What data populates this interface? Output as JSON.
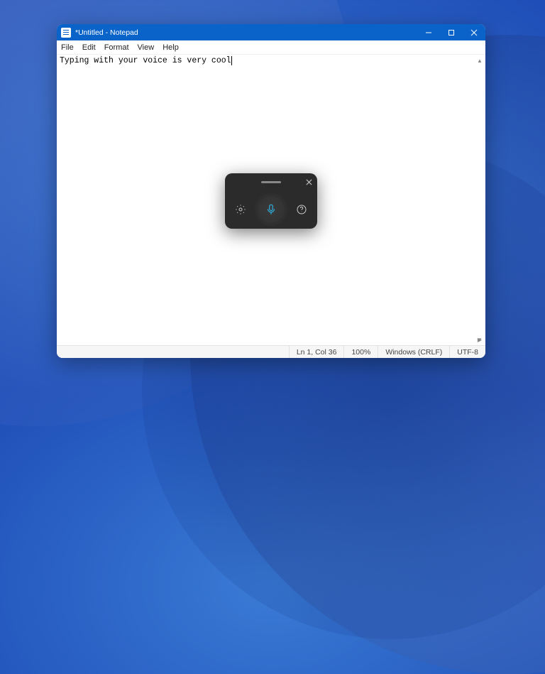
{
  "window": {
    "title": "*Untitled - Notepad"
  },
  "menu": {
    "file": "File",
    "edit": "Edit",
    "format": "Format",
    "view": "View",
    "help": "Help"
  },
  "editor": {
    "content": "Typing with your voice is very cool"
  },
  "status": {
    "position": "Ln 1, Col 36",
    "zoom": "100%",
    "line_ending": "Windows (CRLF)",
    "encoding": "UTF-8"
  },
  "voice_panel": {
    "settings_icon": "settings",
    "mic_icon": "microphone",
    "help_icon": "help",
    "close_icon": "close"
  }
}
